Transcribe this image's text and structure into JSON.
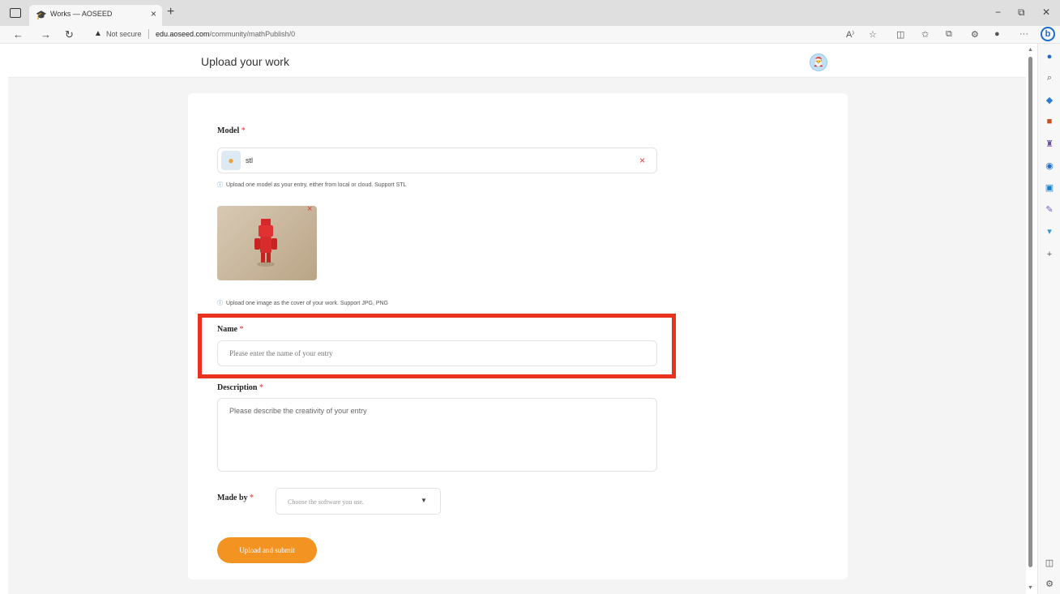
{
  "browser": {
    "tab_title": "Works — AOSEED",
    "tab_close": "×",
    "new_tab": "+",
    "window_minimize": "−",
    "window_restore": "⧉",
    "window_close": "✕",
    "not_secure": "Not secure",
    "url_host": "edu.aoseed.com",
    "url_path": "/community/mathPublish/0",
    "read_aloud": "A⁾",
    "more": "···",
    "bing": "b"
  },
  "header": {
    "title": "Upload your work"
  },
  "form": {
    "model": {
      "label": "Model",
      "required": "*",
      "file_name": "stl",
      "remove": "×",
      "hint": "Upload one model as your entry, either from local or cloud. Support STL"
    },
    "cover": {
      "remove": "×",
      "hint": "Upload one image as the cover of your work. Support JPG, PNG"
    },
    "name": {
      "label": "Name",
      "required": "*",
      "placeholder": "Please enter the name of your entry"
    },
    "description": {
      "label": "Description",
      "required": "*",
      "placeholder": "Please describe the creativity of your entry"
    },
    "made_by": {
      "label": "Made by",
      "required": "*",
      "placeholder": "Choose the software you use."
    },
    "submit_label": "Upload and submit"
  },
  "colors": {
    "accent": "#f39321",
    "highlight": "#e8321f",
    "required": "#e02f2f",
    "info": "#3a8fd0"
  }
}
